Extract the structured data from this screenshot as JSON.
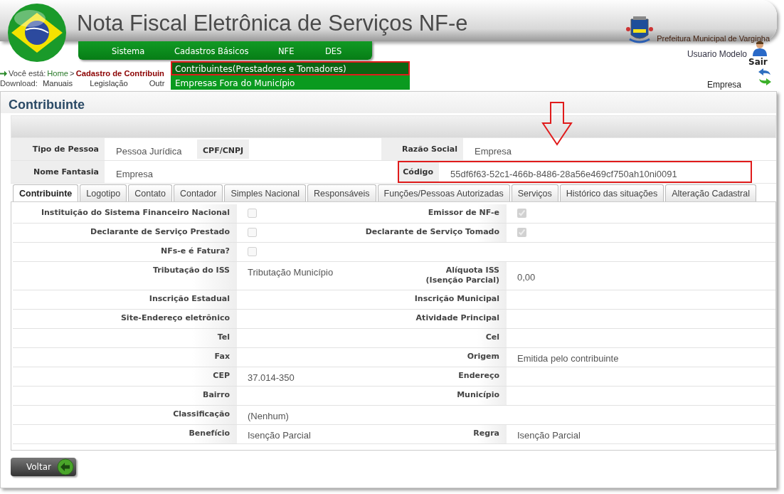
{
  "header": {
    "title": "Nota Fiscal Eletrônica de Serviços NF-e",
    "municipality": "Prefeitura Municipal de Varginha"
  },
  "menu": [
    {
      "label": "Sistema"
    },
    {
      "label": "Cadastros Básicos"
    },
    {
      "label": "NFE"
    },
    {
      "label": "DES"
    }
  ],
  "dropdown": [
    {
      "label": "Contribuintes(Prestadores e Tomadores)",
      "selected": true
    },
    {
      "label": "Empresas Fora do Município",
      "selected": false
    }
  ],
  "breadcrumb": {
    "prefix": "Você está:",
    "home": "Home",
    "separator": ">",
    "current": "Cadastro de Contribuin"
  },
  "downloads": {
    "label": "Download:",
    "links": [
      "Manuais",
      "Legislação",
      "Outr"
    ]
  },
  "user": {
    "name": "Usuario Modelo",
    "logout": "Sair",
    "company": "Empresa"
  },
  "page_title": "Contribuinte",
  "summary": [
    {
      "left": {
        "label": "Tipo de Pessoa",
        "value": "Pessoa Jurídica",
        "tag": "CPF/CNPJ"
      },
      "right": {
        "label": "Razão Social",
        "value": "Empresa"
      }
    },
    {
      "left": {
        "label": "Nome Fantasia",
        "value": "Empresa"
      },
      "right": {
        "label": "Código",
        "value": "55df6f63-52c1-466b-8486-28a56e469cf750ah10ni0091",
        "highlighted": true
      }
    }
  ],
  "tabs": [
    {
      "label": "Contribuinte",
      "selected": true
    },
    {
      "label": "Logotipo",
      "selected": false
    },
    {
      "label": "Contato",
      "selected": false
    },
    {
      "label": "Contador",
      "selected": false
    },
    {
      "label": "Simples Nacional",
      "selected": false
    },
    {
      "label": "Responsáveis",
      "selected": false
    },
    {
      "label": "Funções/Pessoas Autorizadas",
      "selected": false
    },
    {
      "label": "Serviços",
      "selected": false
    },
    {
      "label": "Histórico das situações",
      "selected": false
    },
    {
      "label": "Alteração Cadastral",
      "selected": false
    }
  ],
  "fields": [
    {
      "cells": [
        {
          "kind": "checkbox",
          "label": "Instituição do Sistema Financeiro Nacional",
          "checked": false
        },
        {
          "kind": "checkbox",
          "label": "Emissor de NF-e",
          "checked": true
        }
      ]
    },
    {
      "cells": [
        {
          "kind": "checkbox",
          "label": "Declarante de Serviço Prestado",
          "checked": false
        },
        {
          "kind": "checkbox",
          "label": "Declarante de Serviço Tomado",
          "checked": true
        }
      ]
    },
    {
      "cells": [
        {
          "kind": "checkbox",
          "label": "NFs-e é Fatura?",
          "checked": false
        }
      ]
    },
    {
      "cells": [
        {
          "kind": "text",
          "label": "Tributação do ISS",
          "value": "Tributação Município"
        },
        {
          "kind": "text",
          "label": "Alíquota ISS\n(Isenção Parcial)",
          "value": "0,00"
        }
      ]
    },
    {
      "cells": [
        {
          "kind": "text",
          "label": "Inscrição Estadual"
        },
        {
          "kind": "text",
          "label": "Inscrição Municipal"
        }
      ]
    },
    {
      "cells": [
        {
          "kind": "text",
          "label": "Site-Endereço eletrônico"
        },
        {
          "kind": "text",
          "label": "Atividade Principal"
        }
      ]
    },
    {
      "cells": [
        {
          "kind": "text",
          "label": "Tel"
        },
        {
          "kind": "text",
          "label": "Cel"
        }
      ]
    },
    {
      "cells": [
        {
          "kind": "text",
          "label": "Fax"
        },
        {
          "kind": "text",
          "label": "Origem",
          "value": "Emitida pelo contribuinte"
        }
      ]
    },
    {
      "cells": [
        {
          "kind": "text",
          "label": "CEP",
          "value": "37.014-350"
        },
        {
          "kind": "text",
          "label": "Endereço"
        }
      ]
    },
    {
      "cells": [
        {
          "kind": "text",
          "label": "Bairro"
        },
        {
          "kind": "text",
          "label": "Município"
        }
      ]
    },
    {
      "cells": [
        {
          "kind": "text",
          "label": "Classificação",
          "value": "(Nenhum)"
        }
      ]
    },
    {
      "cells": [
        {
          "kind": "text",
          "label": "Benefício",
          "value": "Isenção Parcial"
        },
        {
          "kind": "text",
          "label": "Regra",
          "value": "Isenção Parcial"
        }
      ]
    }
  ],
  "back_button": "Voltar"
}
